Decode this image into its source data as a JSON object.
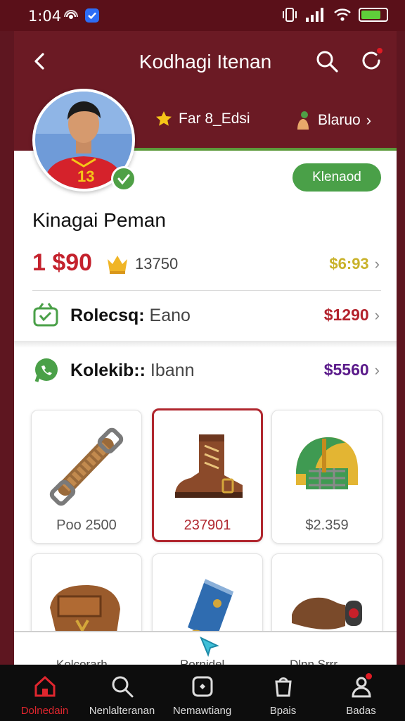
{
  "status_bar": {
    "time": "1:04"
  },
  "header": {
    "title": "Kodhagi Itenan",
    "stat1_label": "Far 8_Edsi",
    "stat2_label": "Blaruo"
  },
  "profile": {
    "jersey_number": "13",
    "status_pill": "Klenaod",
    "name": "Kinagai Peman",
    "price": "1 $90",
    "count": "13750",
    "right_value": "$6:93"
  },
  "rows": [
    {
      "label_bold": "Rolecsq:",
      "label_rest": "Eano",
      "value": "$1290",
      "value_color": "#b3222c"
    },
    {
      "label_bold": "Kolekib::",
      "label_rest": "Ibann",
      "value": "$5560",
      "value_color": "#5a1a8a"
    }
  ],
  "items": [
    {
      "caption": "Poo 2500"
    },
    {
      "caption": "237901"
    },
    {
      "caption": "$2.359"
    }
  ],
  "items_row2_captions": [
    "Kolcorarh",
    "Rornidel",
    "Dlnn Srrr"
  ],
  "bottom_nav": [
    {
      "label": "Dolnedain",
      "active": true
    },
    {
      "label": "Nenlalteranan",
      "active": false
    },
    {
      "label": "Nemawtiang",
      "active": false
    },
    {
      "label": "Bpais",
      "active": false
    },
    {
      "label": "Badas",
      "active": false
    }
  ],
  "colors": {
    "brand": "#6b1a24",
    "accent": "#4aa048",
    "danger": "#c4222d"
  }
}
